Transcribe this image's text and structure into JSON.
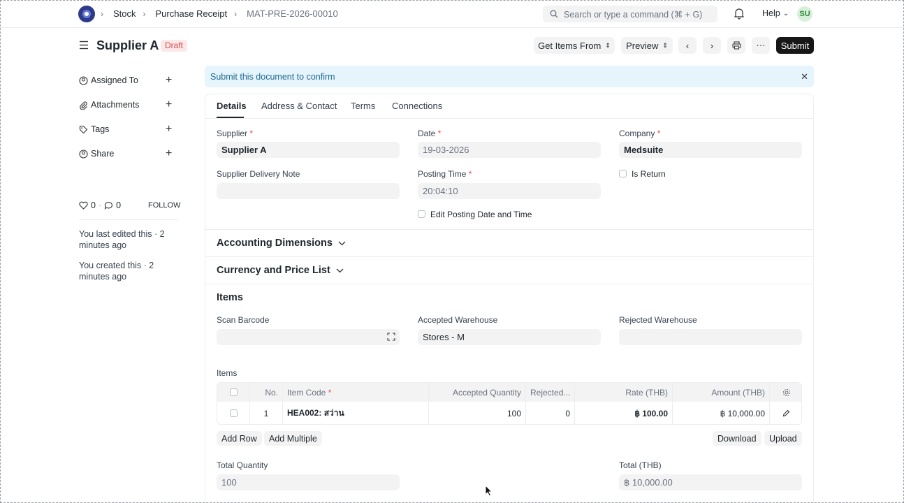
{
  "navbar": {
    "breadcrumbs": [
      "Stock",
      "Purchase Receipt",
      "MAT-PRE-2026-00010"
    ],
    "search_placeholder": "Search or type a command (⌘ + G)",
    "help_label": "Help",
    "avatar_initials": "SU"
  },
  "page": {
    "title": "Supplier A",
    "status": "Draft",
    "actions": {
      "get_items_from": "Get Items From",
      "preview": "Preview",
      "submit": "Submit"
    }
  },
  "sidebar": {
    "items": [
      {
        "label": "Assigned To",
        "icon": "user-check-icon"
      },
      {
        "label": "Attachments",
        "icon": "paperclip-icon"
      },
      {
        "label": "Tags",
        "icon": "tag-icon"
      },
      {
        "label": "Share",
        "icon": "share-icon"
      }
    ],
    "likes": "0",
    "comments": "0",
    "follow_label": "FOLLOW",
    "last_edited": "You last edited this · 2 minutes ago",
    "created": "You created this · 2 minutes ago"
  },
  "alert": {
    "message": "Submit this document to confirm"
  },
  "tabs": [
    "Details",
    "Address & Contact",
    "Terms",
    "Connections"
  ],
  "form": {
    "supplier_label": "Supplier",
    "supplier_value": "Supplier A",
    "date_label": "Date",
    "date_value": "19-03-2026",
    "company_label": "Company",
    "company_value": "Medsuite",
    "supplier_delivery_note_label": "Supplier Delivery Note",
    "supplier_delivery_note_value": "",
    "posting_time_label": "Posting Time",
    "posting_time_value": "20:04:10",
    "is_return_label": "Is Return",
    "edit_posting_label": "Edit Posting Date and Time"
  },
  "sections": {
    "accounting_dimensions": "Accounting Dimensions",
    "currency_price_list": "Currency and Price List",
    "items": "Items"
  },
  "items_section": {
    "scan_barcode_label": "Scan Barcode",
    "accepted_warehouse_label": "Accepted Warehouse",
    "accepted_warehouse_value": "Stores - M",
    "rejected_warehouse_label": "Rejected Warehouse",
    "items_table_label": "Items"
  },
  "items_table": {
    "columns": {
      "no": "No.",
      "item_code": "Item Code",
      "accepted_qty": "Accepted Quantity",
      "rejected": "Rejected...",
      "rate": "Rate (THB)",
      "amount": "Amount (THB)"
    },
    "rows": [
      {
        "no": "1",
        "item_code": "HEA002: สว่าน",
        "accepted_qty": "100",
        "rejected": "0",
        "rate": "฿ 100.00",
        "amount": "฿ 10,000.00"
      }
    ],
    "buttons": {
      "add_row": "Add Row",
      "add_multiple": "Add Multiple",
      "download": "Download",
      "upload": "Upload"
    }
  },
  "totals": {
    "total_quantity_label": "Total Quantity",
    "total_quantity_value": "100",
    "total_label": "Total (THB)",
    "total_value": "฿ 10,000.00"
  }
}
